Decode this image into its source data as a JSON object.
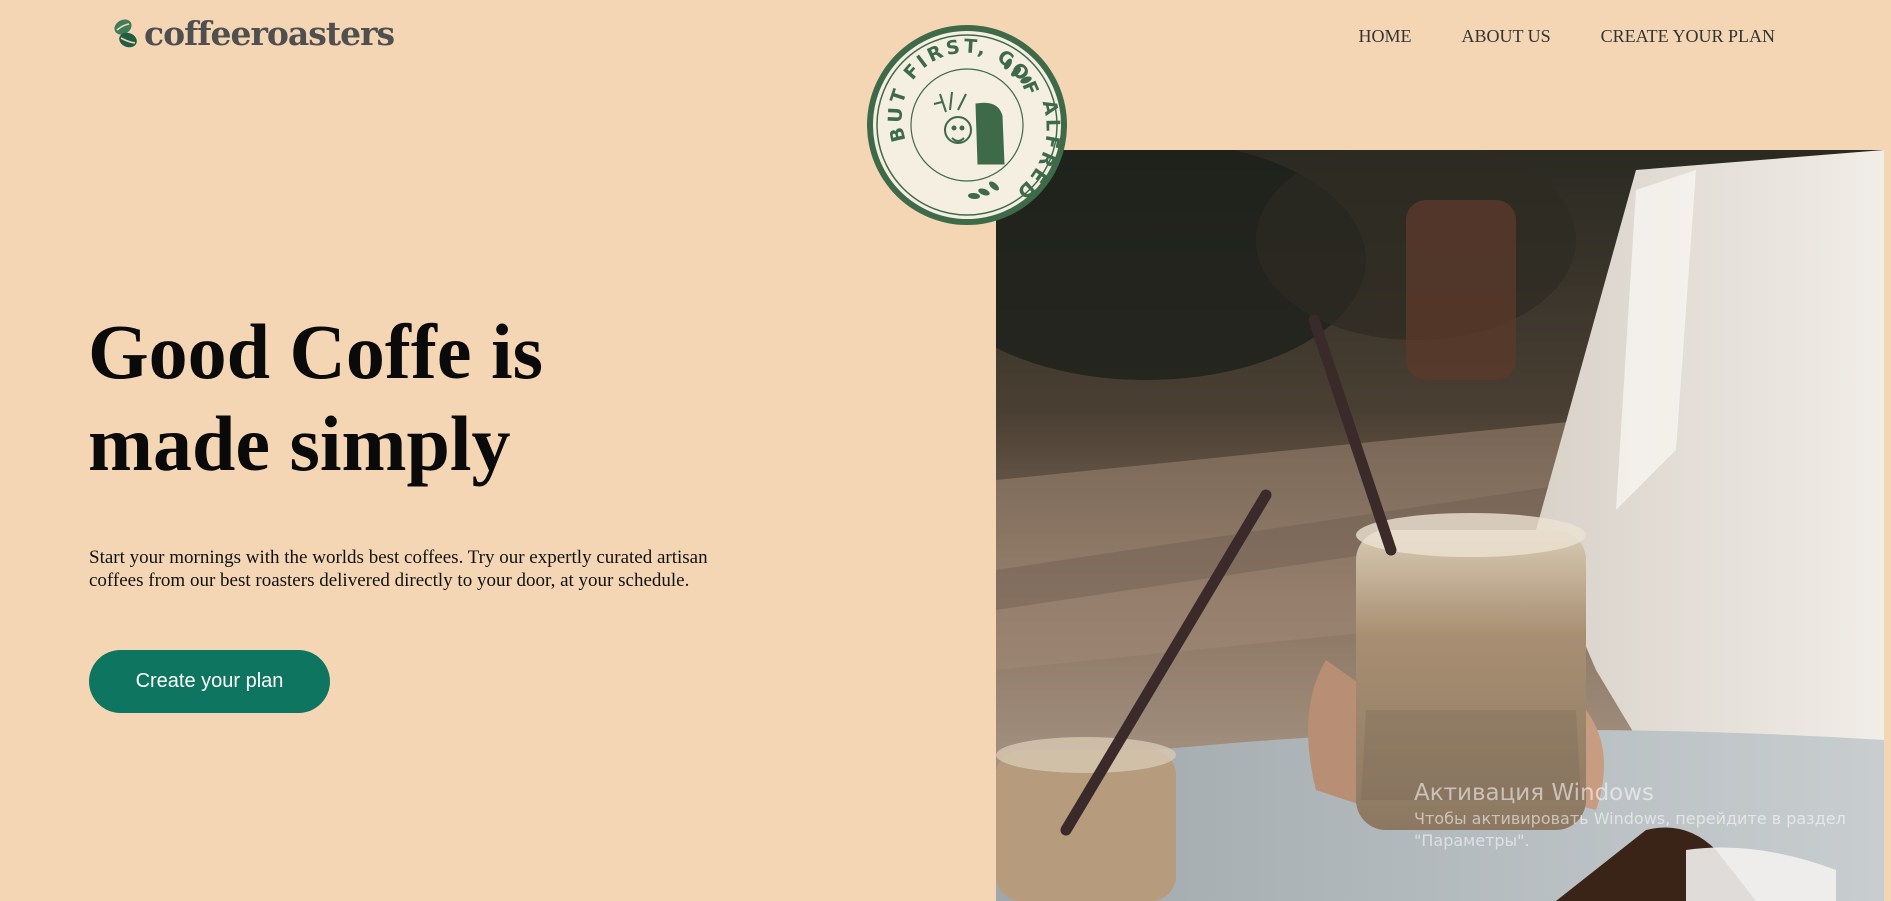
{
  "brand": {
    "name": "coffeeroasters",
    "icon": "coffee-beans-icon",
    "accent_color": "#0e7560"
  },
  "nav": {
    "items": [
      {
        "label": "HOME"
      },
      {
        "label": "ABOUT US"
      },
      {
        "label": "CREATE YOUR PLAN"
      }
    ]
  },
  "badge": {
    "text": "BUT FIRST, COFFEE.",
    "name": "ALFRED",
    "color": "#3f6a4a"
  },
  "hero": {
    "title_line1": "Good Coffe is",
    "title_line2": "made simply",
    "description_line1": "Start your mornings with the worlds best coffees. Try our expertly curated artisan",
    "description_line2": "coffees from our best roasters delivered directly to your door, at your schedule.",
    "cta_label": "Create your plan",
    "background_color": "#f4d6b5"
  },
  "watermark": {
    "title": "Активация Windows",
    "subtitle": "Чтобы активировать Windows, перейдите в раздел \"Параметры\"."
  }
}
